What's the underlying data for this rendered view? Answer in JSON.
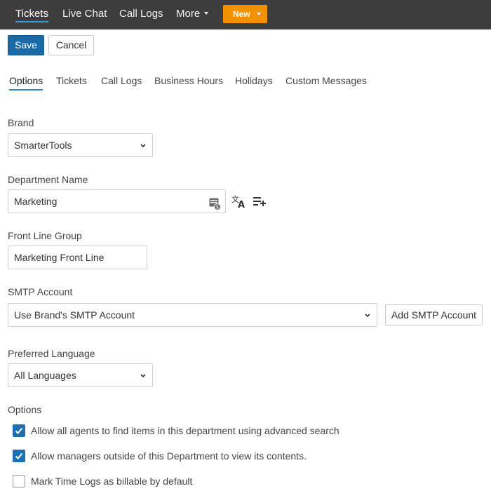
{
  "topnav": {
    "items": [
      "Tickets",
      "Live Chat",
      "Call Logs",
      "More"
    ],
    "new_label": "New"
  },
  "toolbar": {
    "save_label": "Save",
    "cancel_label": "Cancel"
  },
  "tabs": [
    "Options",
    "Tickets",
    "Call Logs",
    "Business Hours",
    "Holidays",
    "Custom Messages"
  ],
  "form": {
    "brand": {
      "label": "Brand",
      "value": "SmarterTools"
    },
    "department_name": {
      "label": "Department Name",
      "value": "Marketing"
    },
    "front_line_group": {
      "label": "Front Line Group",
      "value": "Marketing Front Line"
    },
    "smtp_account": {
      "label": "SMTP Account",
      "value": "Use Brand's SMTP Account",
      "add_label": "Add SMTP Account"
    },
    "preferred_language": {
      "label": "Preferred Language",
      "value": "All Languages"
    },
    "options": {
      "label": "Options",
      "items": [
        {
          "label": "Allow all agents to find items in this department using advanced search",
          "checked": true
        },
        {
          "label": "Allow managers outside of this Department to view its contents.",
          "checked": true
        },
        {
          "label": "Mark Time Logs as billable by default",
          "checked": false
        }
      ]
    }
  },
  "colors": {
    "topbar": "#3d3d3d",
    "accent_orange": "#f39200",
    "primary_blue": "#1a6aa7",
    "tab_underline": "#2a87c7",
    "check_blue": "#1e6fb2"
  },
  "icons": [
    "chevron-down-icon",
    "variable-icon",
    "translate-icon",
    "playlist-add-icon",
    "checkmark-icon"
  ]
}
